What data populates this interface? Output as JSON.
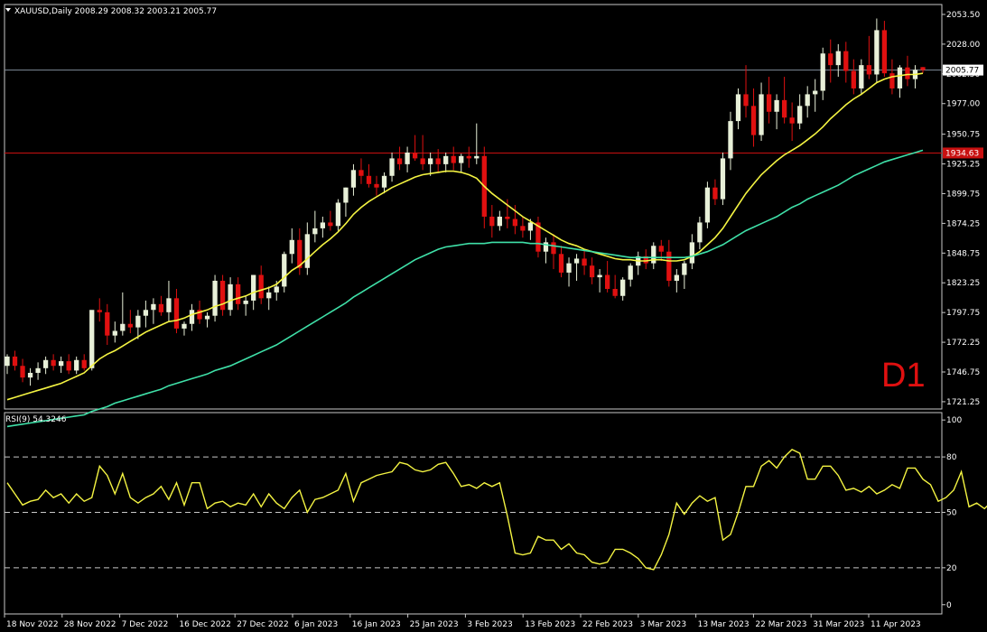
{
  "header": {
    "symbol_line": "XAUUSD,Daily  2008.29 2008.32 2003.21 2005.77",
    "timeframe_badge": "D1"
  },
  "indicator": {
    "label": "RSI(9) 54.3246"
  },
  "colors": {
    "background": "#000000",
    "bull_candle": "#e8f0d8",
    "bear_candle": "#e01010",
    "ma_fast": "#f4f442",
    "ma_slow": "#3fe0a8",
    "rsi_line": "#f4f442",
    "resistance_line": "#c81010",
    "price_line": "#7f8c99"
  },
  "chart_data": [
    {
      "type": "candlestick",
      "ylim": [
        1715,
        2062
      ],
      "yticks": [
        "2053.50",
        "2028.00",
        "2002.50",
        "1977.00",
        "1950.75",
        "1925.25",
        "1899.75",
        "1874.25",
        "1848.75",
        "1823.25",
        "1797.75",
        "1772.25",
        "1746.75",
        "1721.25"
      ],
      "xticks": [
        "18 Nov 2022",
        "28 Nov 2022",
        "7 Dec 2022",
        "16 Dec 2022",
        "27 Dec 2022",
        "6 Jan 2023",
        "16 Jan 2023",
        "25 Jan 2023",
        "3 Feb 2023",
        "13 Feb 2023",
        "22 Feb 2023",
        "3 Mar 2023",
        "13 Mar 2023",
        "22 Mar 2023",
        "31 Mar 2023",
        "11 Apr 2023"
      ],
      "current_price": "2005.77",
      "level_line": "1934.63",
      "candles_ohlc": [
        [
          1752,
          1762,
          1745,
          1760
        ],
        [
          1760,
          1765,
          1748,
          1752
        ],
        [
          1752,
          1758,
          1738,
          1742
        ],
        [
          1742,
          1750,
          1735,
          1746
        ],
        [
          1746,
          1755,
          1740,
          1750
        ],
        [
          1750,
          1760,
          1745,
          1757
        ],
        [
          1757,
          1762,
          1748,
          1752
        ],
        [
          1752,
          1760,
          1746,
          1756
        ],
        [
          1756,
          1762,
          1745,
          1748
        ],
        [
          1748,
          1760,
          1745,
          1757
        ],
        [
          1757,
          1762,
          1748,
          1750
        ],
        [
          1750,
          1785,
          1748,
          1800
        ],
        [
          1800,
          1810,
          1790,
          1798
        ],
        [
          1798,
          1805,
          1770,
          1778
        ],
        [
          1778,
          1790,
          1772,
          1782
        ],
        [
          1782,
          1815,
          1778,
          1788
        ],
        [
          1788,
          1800,
          1780,
          1785
        ],
        [
          1785,
          1800,
          1775,
          1795
        ],
        [
          1795,
          1808,
          1785,
          1800
        ],
        [
          1800,
          1810,
          1788,
          1805
        ],
        [
          1805,
          1812,
          1795,
          1798
        ],
        [
          1798,
          1825,
          1790,
          1810
        ],
        [
          1810,
          1818,
          1780,
          1784
        ],
        [
          1784,
          1790,
          1778,
          1788
        ],
        [
          1788,
          1805,
          1782,
          1800
        ],
        [
          1800,
          1808,
          1788,
          1792
        ],
        [
          1792,
          1798,
          1785,
          1795
        ],
        [
          1795,
          1830,
          1790,
          1825
        ],
        [
          1825,
          1830,
          1795,
          1800
        ],
        [
          1800,
          1828,
          1795,
          1822
        ],
        [
          1822,
          1828,
          1800,
          1805
        ],
        [
          1805,
          1812,
          1795,
          1808
        ],
        [
          1808,
          1830,
          1800,
          1830
        ],
        [
          1830,
          1838,
          1805,
          1810
        ],
        [
          1810,
          1820,
          1800,
          1815
        ],
        [
          1815,
          1825,
          1808,
          1820
        ],
        [
          1820,
          1850,
          1815,
          1848
        ],
        [
          1848,
          1870,
          1840,
          1860
        ],
        [
          1860,
          1870,
          1830,
          1836
        ],
        [
          1836,
          1875,
          1830,
          1865
        ],
        [
          1865,
          1885,
          1858,
          1870
        ],
        [
          1870,
          1880,
          1862,
          1875
        ],
        [
          1875,
          1885,
          1868,
          1872
        ],
        [
          1872,
          1895,
          1868,
          1892
        ],
        [
          1892,
          1905,
          1880,
          1905
        ],
        [
          1905,
          1925,
          1898,
          1920
        ],
        [
          1920,
          1930,
          1908,
          1915
        ],
        [
          1915,
          1925,
          1905,
          1908
        ],
        [
          1908,
          1915,
          1898,
          1905
        ],
        [
          1905,
          1918,
          1900,
          1915
        ],
        [
          1915,
          1935,
          1910,
          1930
        ],
        [
          1930,
          1940,
          1920,
          1925
        ],
        [
          1925,
          1940,
          1918,
          1935
        ],
        [
          1935,
          1950,
          1928,
          1930
        ],
        [
          1930,
          1950,
          1920,
          1925
        ],
        [
          1925,
          1935,
          1915,
          1930
        ],
        [
          1930,
          1938,
          1918,
          1925
        ],
        [
          1925,
          1935,
          1918,
          1932
        ],
        [
          1932,
          1940,
          1920,
          1926
        ],
        [
          1926,
          1934,
          1918,
          1932
        ],
        [
          1932,
          1940,
          1922,
          1930
        ],
        [
          1930,
          1960,
          1925,
          1932
        ],
        [
          1932,
          1940,
          1870,
          1880
        ],
        [
          1880,
          1890,
          1862,
          1872
        ],
        [
          1872,
          1885,
          1868,
          1880
        ],
        [
          1880,
          1895,
          1870,
          1878
        ],
        [
          1878,
          1890,
          1865,
          1872
        ],
        [
          1872,
          1880,
          1862,
          1868
        ],
        [
          1868,
          1878,
          1860,
          1875
        ],
        [
          1875,
          1880,
          1845,
          1850
        ],
        [
          1850,
          1862,
          1840,
          1858
        ],
        [
          1858,
          1865,
          1835,
          1848
        ],
        [
          1848,
          1855,
          1828,
          1832
        ],
        [
          1832,
          1845,
          1820,
          1840
        ],
        [
          1840,
          1848,
          1825,
          1844
        ],
        [
          1844,
          1852,
          1830,
          1838
        ],
        [
          1838,
          1845,
          1822,
          1828
        ],
        [
          1828,
          1835,
          1815,
          1830
        ],
        [
          1830,
          1842,
          1815,
          1818
        ],
        [
          1818,
          1830,
          1810,
          1812
        ],
        [
          1812,
          1828,
          1808,
          1826
        ],
        [
          1826,
          1840,
          1820,
          1838
        ],
        [
          1838,
          1850,
          1830,
          1846
        ],
        [
          1846,
          1852,
          1835,
          1840
        ],
        [
          1840,
          1858,
          1835,
          1855
        ],
        [
          1855,
          1860,
          1842,
          1850
        ],
        [
          1850,
          1860,
          1820,
          1825
        ],
        [
          1825,
          1835,
          1815,
          1830
        ],
        [
          1830,
          1842,
          1818,
          1840
        ],
        [
          1840,
          1865,
          1835,
          1858
        ],
        [
          1858,
          1880,
          1852,
          1875
        ],
        [
          1875,
          1910,
          1870,
          1905
        ],
        [
          1905,
          1912,
          1890,
          1895
        ],
        [
          1895,
          1935,
          1890,
          1930
        ],
        [
          1930,
          1970,
          1920,
          1962
        ],
        [
          1962,
          1990,
          1955,
          1985
        ],
        [
          1985,
          2010,
          1965,
          1975
        ],
        [
          1975,
          1990,
          1940,
          1950
        ],
        [
          1950,
          1995,
          1945,
          1985
        ],
        [
          1985,
          2000,
          1960,
          1970
        ],
        [
          1970,
          1985,
          1955,
          1980
        ],
        [
          1980,
          2000,
          1960,
          1965
        ],
        [
          1965,
          1978,
          1945,
          1960
        ],
        [
          1960,
          1985,
          1955,
          1975
        ],
        [
          1975,
          1992,
          1965,
          1985
        ],
        [
          1985,
          1998,
          1970,
          1988
        ],
        [
          1988,
          2025,
          1980,
          2020
        ],
        [
          2020,
          2032,
          1995,
          2010
        ],
        [
          2010,
          2028,
          2000,
          2022
        ],
        [
          2022,
          2030,
          1995,
          2005
        ],
        [
          2005,
          2015,
          1985,
          1990
        ],
        [
          1990,
          2015,
          1985,
          2010
        ],
        [
          2010,
          2035,
          1998,
          2002
        ],
        [
          2002,
          2050,
          1995,
          2040
        ],
        [
          2040,
          2048,
          2000,
          2003
        ],
        [
          2003,
          2015,
          1985,
          1990
        ],
        [
          1990,
          2010,
          1982,
          2008
        ],
        [
          2008,
          2018,
          1992,
          1998
        ],
        [
          1998,
          2010,
          1990,
          2006
        ],
        [
          2008.29,
          2008.32,
          2003.21,
          2005.77
        ]
      ],
      "series": [
        {
          "values": [
            1723,
            1725,
            1727,
            1729,
            1731,
            1733,
            1735,
            1737,
            1740,
            1743,
            1746,
            1752,
            1758,
            1762,
            1765,
            1769,
            1773,
            1777,
            1781,
            1784,
            1787,
            1790,
            1791,
            1793,
            1796,
            1798,
            1800,
            1803,
            1805,
            1808,
            1810,
            1812,
            1815,
            1817,
            1819,
            1822,
            1828,
            1834,
            1838,
            1844,
            1850,
            1856,
            1861,
            1867,
            1874,
            1882,
            1888,
            1893,
            1897,
            1901,
            1905,
            1908,
            1911,
            1914,
            1916,
            1917,
            1918,
            1919,
            1919,
            1918,
            1916,
            1913,
            1906,
            1900,
            1895,
            1890,
            1885,
            1880,
            1876,
            1872,
            1868,
            1864,
            1860,
            1857,
            1855,
            1852,
            1850,
            1848,
            1846,
            1844,
            1843,
            1843,
            1842,
            1842,
            1843,
            1843,
            1842,
            1842,
            1843,
            1846,
            1850,
            1856,
            1862,
            1870,
            1880,
            1890,
            1900,
            1908,
            1916,
            1922,
            1928,
            1933,
            1937,
            1941,
            1946,
            1951,
            1957,
            1964,
            1970,
            1976,
            1981,
            1985,
            1990,
            1995,
            1998,
            2000,
            2001,
            2002,
            2002,
            2003
          ]
        },
        {
          "values": [
            1700,
            1701,
            1702,
            1703,
            1704,
            1705,
            1706,
            1707,
            1708,
            1709,
            1710,
            1713,
            1715,
            1717,
            1720,
            1722,
            1724,
            1726,
            1728,
            1730,
            1732,
            1735,
            1737,
            1739,
            1741,
            1743,
            1745,
            1748,
            1750,
            1752,
            1755,
            1758,
            1761,
            1764,
            1767,
            1770,
            1774,
            1778,
            1782,
            1786,
            1790,
            1794,
            1798,
            1802,
            1806,
            1811,
            1815,
            1819,
            1823,
            1827,
            1831,
            1835,
            1839,
            1843,
            1846,
            1849,
            1852,
            1854,
            1855,
            1856,
            1857,
            1857,
            1857,
            1858,
            1858,
            1858,
            1858,
            1858,
            1857,
            1857,
            1856,
            1855,
            1854,
            1853,
            1852,
            1851,
            1850,
            1849,
            1848,
            1847,
            1846,
            1845,
            1845,
            1845,
            1845,
            1845,
            1845,
            1845,
            1845,
            1846,
            1848,
            1850,
            1853,
            1856,
            1860,
            1864,
            1868,
            1871,
            1874,
            1877,
            1880,
            1884,
            1888,
            1891,
            1895,
            1898,
            1901,
            1904,
            1907,
            1911,
            1915,
            1918,
            1921,
            1924,
            1927,
            1929,
            1931,
            1933,
            1935,
            1937
          ]
        }
      ]
    },
    {
      "type": "line",
      "ylim": [
        -5,
        104
      ],
      "yticks": [
        "100",
        "80",
        "50",
        "20",
        "0"
      ],
      "levels": [
        80,
        50,
        20
      ],
      "series": [
        {
          "values": [
            66,
            60,
            54,
            56,
            57,
            62,
            58,
            60,
            55,
            60,
            56,
            58,
            75,
            70,
            60,
            71,
            58,
            55,
            58,
            60,
            64,
            57,
            66,
            54,
            66,
            66,
            52,
            55,
            56,
            53,
            55,
            54,
            60,
            53,
            60,
            55,
            52,
            58,
            62,
            50,
            57,
            58,
            60,
            62,
            71,
            56,
            66,
            68,
            70,
            71,
            72,
            77,
            76,
            73,
            72,
            73,
            76,
            77,
            71,
            64,
            65,
            63,
            66,
            64,
            66,
            48,
            28,
            27,
            28,
            37,
            35,
            35,
            30,
            33,
            28,
            27,
            23,
            22,
            23,
            30,
            30,
            28,
            25,
            20,
            19,
            27,
            38,
            55,
            49,
            55,
            59,
            56,
            58,
            35,
            38,
            50,
            64,
            64,
            75,
            78,
            74,
            80,
            84,
            82,
            68,
            68,
            75,
            75,
            70,
            62,
            63,
            61,
            64,
            60,
            62,
            65,
            63,
            74,
            74,
            68,
            65,
            56,
            58,
            62,
            72,
            53,
            55,
            52,
            56,
            55
          ]
        }
      ]
    }
  ]
}
